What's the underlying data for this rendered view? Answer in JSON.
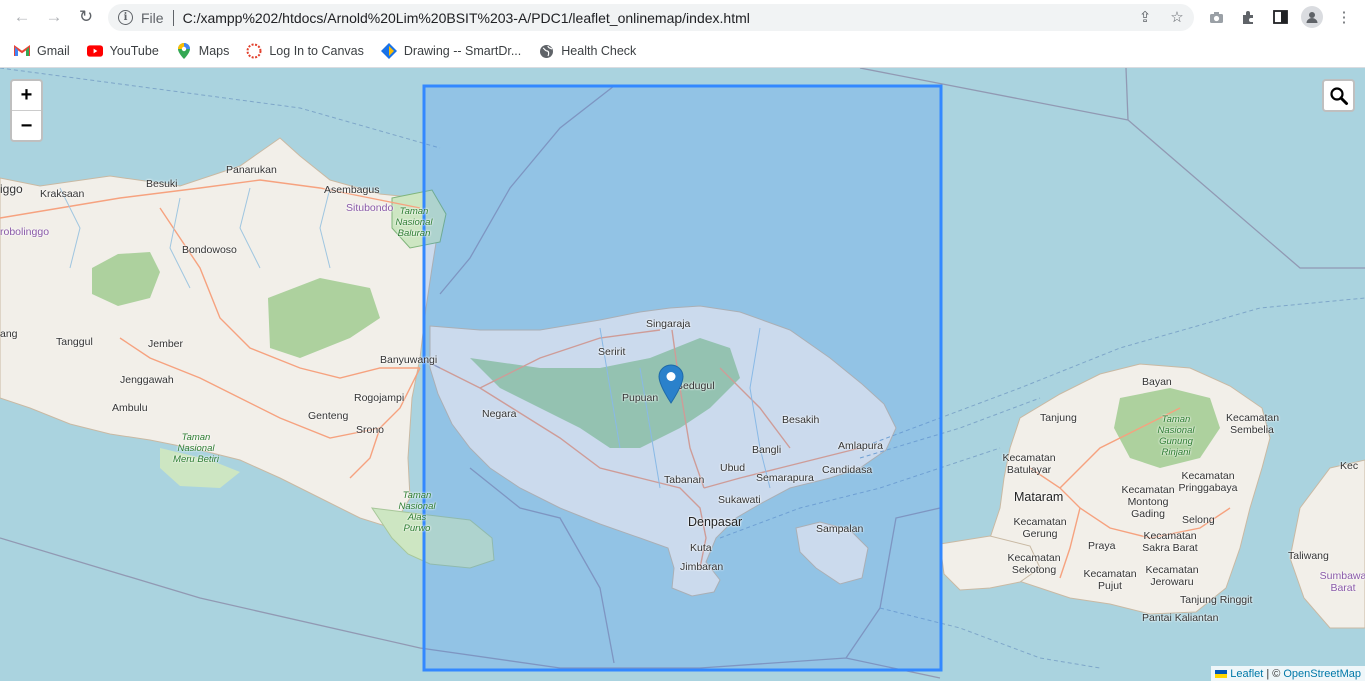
{
  "browser": {
    "file_label": "File",
    "url": "C:/xampp%202/htdocs/Arnold%20Lim%20BSIT%203-A/PDC1/leaflet_onlinemap/index.html"
  },
  "bookmarks": [
    {
      "label": "Gmail",
      "icon": "gmail-icon",
      "color": "#ea4335"
    },
    {
      "label": "YouTube",
      "icon": "youtube-icon",
      "color": "#ff0000"
    },
    {
      "label": "Maps",
      "icon": "maps-icon",
      "color": "#34a853"
    },
    {
      "label": "Log In to Canvas",
      "icon": "canvas-icon",
      "color": "#e13f2b"
    },
    {
      "label": "Drawing -- SmartDr...",
      "icon": "smartdraw-icon",
      "color": "#1a73e8"
    },
    {
      "label": "Health Check",
      "icon": "globe-icon",
      "color": "#5f6368"
    }
  ],
  "map": {
    "zoom_in": "+",
    "zoom_out": "−",
    "rectangle_color": "#3388ff",
    "places": {
      "kraksaan": "Kraksaan",
      "besuki": "Besuki",
      "panarukan": "Panarukan",
      "asembagus": "Asembagus",
      "situbondo": "Situbondo",
      "baluran": "Taman Nasional Baluran",
      "probolinggo": "robolinggo",
      "iggo": "iggo",
      "bondowoso": "Bondowoso",
      "tanggul": "Tanggul",
      "jember": "Jember",
      "banyuwangi": "Banyuwangi",
      "jenggawah": "Jenggawah",
      "ambulu": "Ambulu",
      "genteng": "Genteng",
      "rogojampi": "Rogojampi",
      "srono": "Srono",
      "meru_betiri": "Taman Nasional Meru Betiri",
      "alas_purwo": "Taman Nasional Alas Purwo",
      "ang": "ang",
      "singaraja": "Singaraja",
      "seririt": "Seririt",
      "bedugul": "Bedugul",
      "pupuan": "Pupuan",
      "negara": "Negara",
      "besakih": "Besakih",
      "bangli": "Bangli",
      "amlapura": "Amlapura",
      "candidasa": "Candidasa",
      "ubud": "Ubud",
      "semarapura": "Semarapura",
      "tabanan": "Tabanan",
      "sukawati": "Sukawati",
      "denpasar": "Denpasar",
      "kuta": "Kuta",
      "jimbaran": "Jimbaran",
      "sampalan": "Sampalan",
      "bayan": "Bayan",
      "tanjung": "Tanjung",
      "rinjani": "Taman Nasional Gunung Rinjani",
      "sembelia": "Kecamatan Sembelia",
      "batulayar": "Kecamatan Batulayar",
      "mataram": "Mataram",
      "pringgabaya": "Kecamatan Pringgabaya",
      "montong": "Kecamatan Montong Gading",
      "gerung": "Kecamatan Gerung",
      "selong": "Selong",
      "praya": "Praya",
      "sakra_barat": "Kecamatan Sakra Barat",
      "sekotong": "Kecamatan Sekotong",
      "pujut": "Kecamatan Pujut",
      "jerowaru": "Kecamatan Jerowaru",
      "taliwang": "Taliwang",
      "sumbawa_barat": "Sumbawa Barat",
      "tanjung_ringgit": "Tanjung Ringgit",
      "pantai_kaliantan": "Pantai Kaliantan",
      "kec": "Kec"
    },
    "attribution": {
      "leaflet": "Leaflet",
      "separator": " | © ",
      "osm": "OpenStreetMap"
    }
  }
}
